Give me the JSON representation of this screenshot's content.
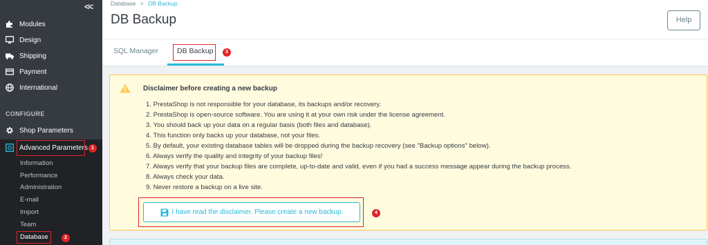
{
  "sidebar": {
    "collapse_label": "<<",
    "items": [
      {
        "label": "Modules",
        "icon": "puzzle-icon"
      },
      {
        "label": "Design",
        "icon": "monitor-icon"
      },
      {
        "label": "Shipping",
        "icon": "truck-icon"
      },
      {
        "label": "Payment",
        "icon": "credit-card-icon"
      },
      {
        "label": "International",
        "icon": "globe-icon"
      }
    ],
    "section_label": "CONFIGURE",
    "shop_parameters": {
      "label": "Shop Parameters",
      "icon": "gear-icon"
    },
    "advanced_parameters": {
      "label": "Advanced Parameters",
      "icon": "settings-box-icon"
    },
    "sub_items": [
      "Information",
      "Performance",
      "Administration",
      "E-mail",
      "Import",
      "Team",
      "Database"
    ]
  },
  "header": {
    "breadcrumb_parent": "Database",
    "breadcrumb_sep": ">",
    "breadcrumb_current": "DB Backup",
    "title": "DB Backup",
    "help_label": "Help",
    "tabs": [
      {
        "label": "SQL Manager",
        "active": false
      },
      {
        "label": "DB Backup",
        "active": true
      }
    ]
  },
  "warning": {
    "title": "Disclaimer before creating a new backup",
    "rules": [
      "1. PrestaShop is not responsible for your database, its backups and/or recovery.",
      "2. PrestaShop is open-source software. You are using it at your own risk under the license agreement.",
      "3. You should back up your data on a regular basis (both files and database).",
      "4. This function only backs up your database, not your files.",
      "5. By default, your existing database tables will be dropped during the backup recovery (see \"Backup options\" below).",
      "6. Always verify the quality and integrity of your backup files!",
      "7. Always verify that your backup files are complete, up-to-date and valid, even if you had a success message appear during the backup process.",
      "8. Always check your data.",
      "9. Never restore a backup on a live site."
    ],
    "confirm_label": "I have read the disclaimer. Please create a new backup."
  },
  "annotations": {
    "badge_1": "1",
    "badge_2": "2",
    "badge_3": "3",
    "badge_4": "4"
  },
  "colors": {
    "accent": "#25b9d7",
    "sidebar_bg": "#363a41",
    "warning_bg": "#fffbdf",
    "warning_border": "#fcc94f",
    "annotation_red": "#e0242a"
  }
}
